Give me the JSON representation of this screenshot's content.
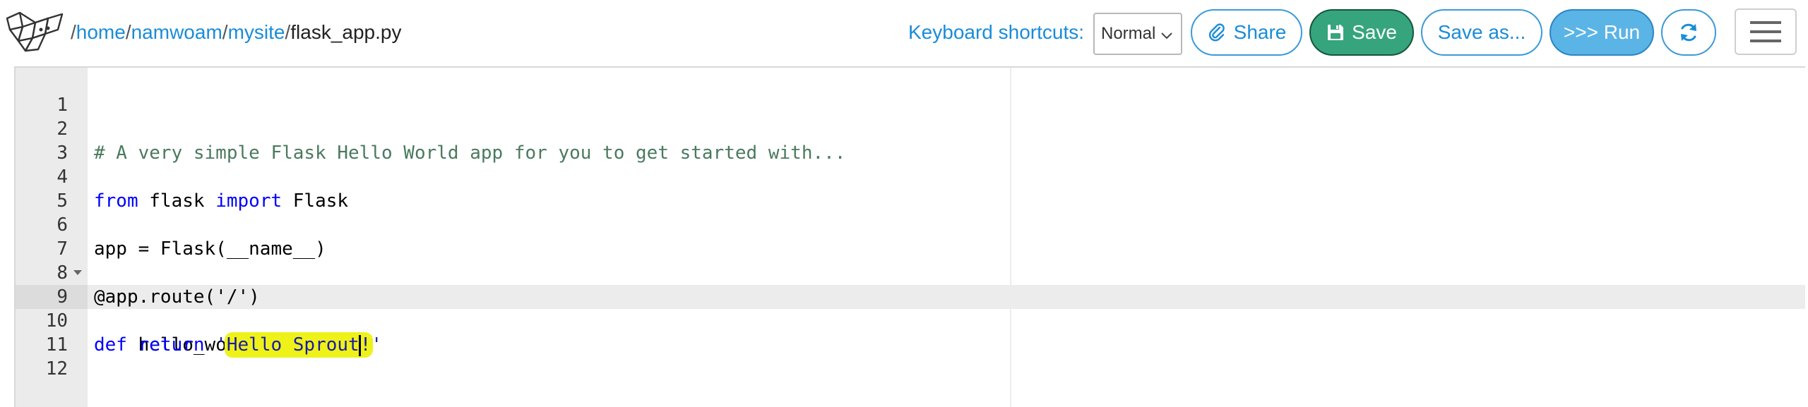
{
  "header": {
    "breadcrumb": {
      "leading_sep": "/",
      "parts": [
        "home",
        "namwoam",
        "mysite"
      ],
      "sep": "/",
      "file": "flask_app.py"
    },
    "keyboard_label": "Keyboard shortcuts:",
    "keyboard_mode": "Normal",
    "buttons": {
      "share": "Share",
      "save": "Save",
      "save_as": "Save as...",
      "run": ">>> Run"
    }
  },
  "editor": {
    "active_line": 10,
    "lines": [
      {
        "n": "1",
        "text": ""
      },
      {
        "n": "2",
        "text": "# A very simple Flask Hello World app for you to get started with..."
      },
      {
        "n": "3",
        "text": ""
      },
      {
        "n": "4",
        "kw1": "from",
        "mid": " flask ",
        "kw2": "import",
        "tail": " Flask"
      },
      {
        "n": "5",
        "text": ""
      },
      {
        "n": "6",
        "text": "app = Flask(__name__)"
      },
      {
        "n": "7",
        "text": ""
      },
      {
        "n": "8",
        "text": "@app.route('/')"
      },
      {
        "n": "9",
        "kw": "def",
        "tail": " hello_world():"
      },
      {
        "n": "10",
        "indent": "    ",
        "kw": "return",
        "sp": " ",
        "q1": "'",
        "hl_text": "Hello Sprout",
        "hl_bang": "!",
        "q2": "'"
      },
      {
        "n": "11",
        "text": ""
      },
      {
        "n": "12",
        "text": ""
      }
    ]
  },
  "colors": {
    "accent": "#1a8cd8",
    "save": "#36a57e",
    "run": "#5bb4e6",
    "highlight": "#eef218"
  }
}
